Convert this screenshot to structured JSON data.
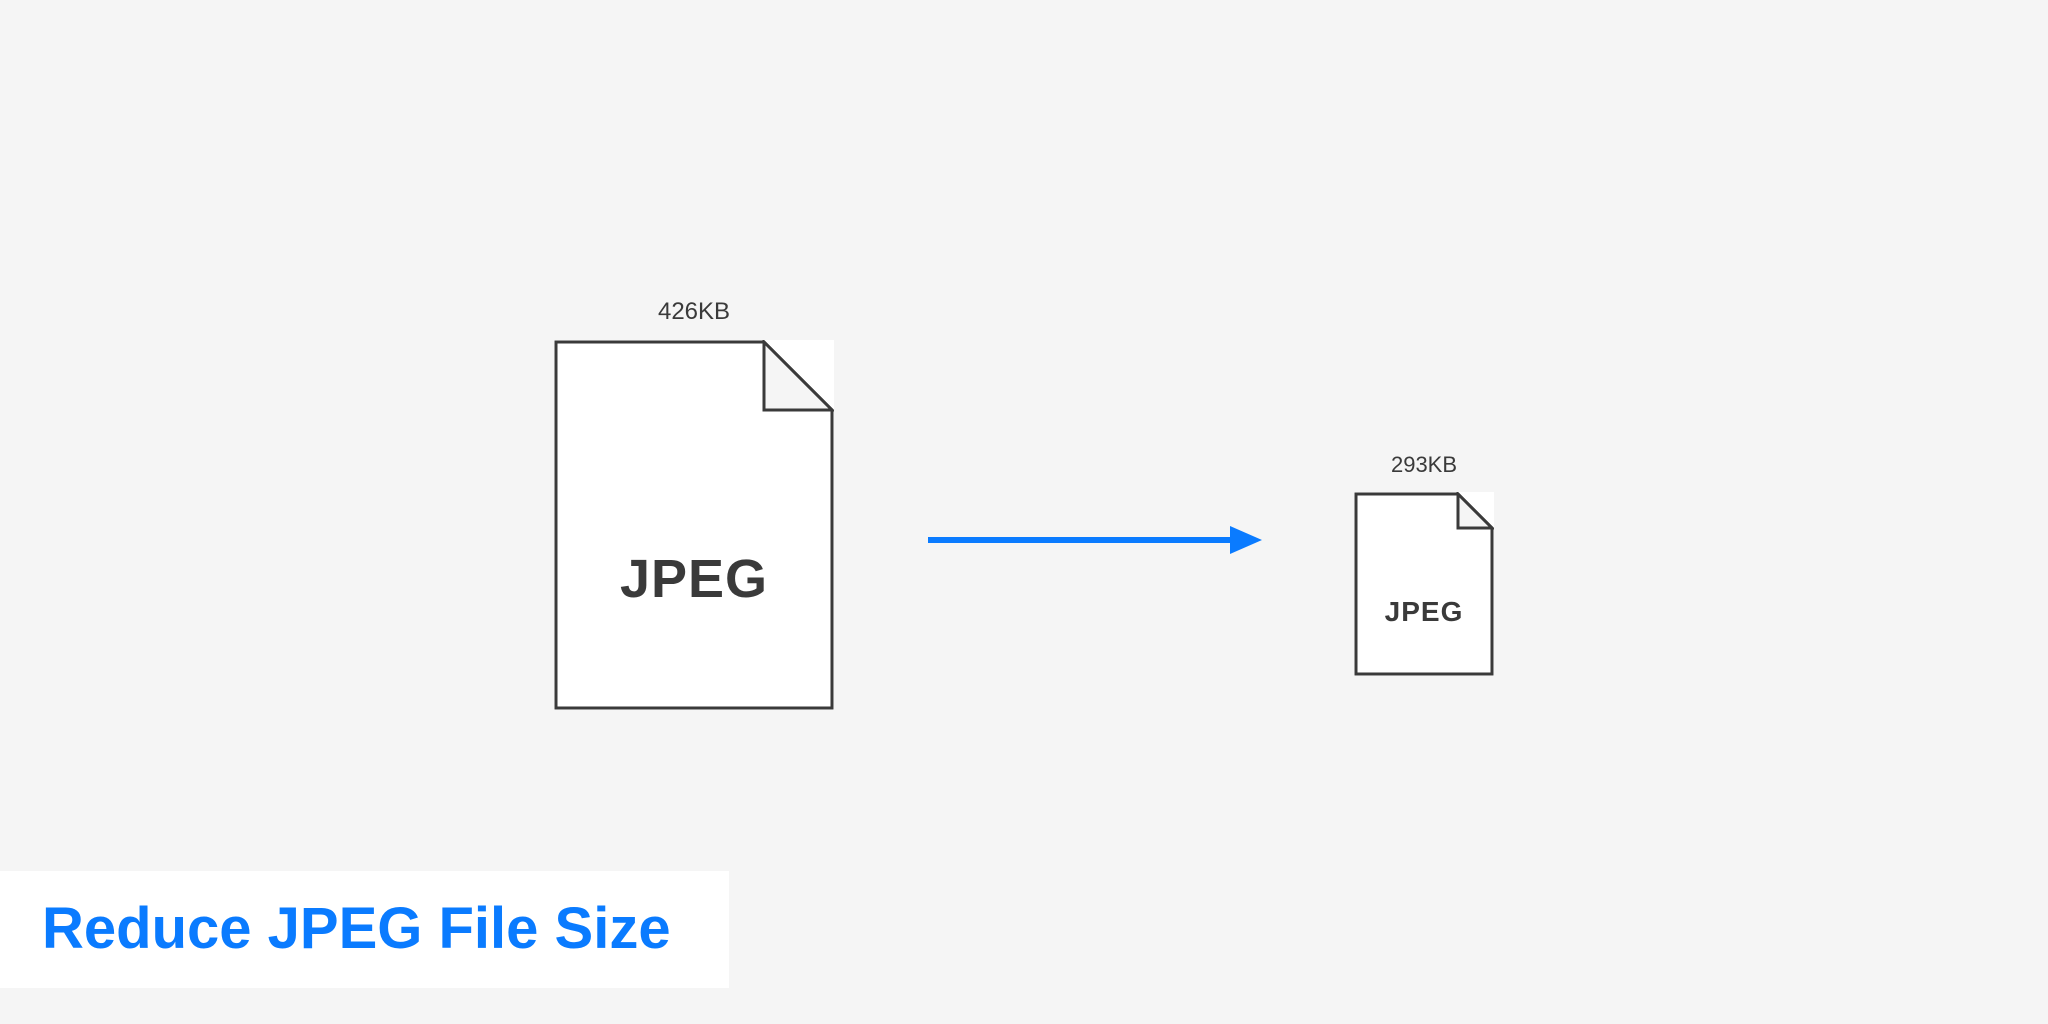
{
  "diagram": {
    "large_file": {
      "size_label": "426KB",
      "format_label": "JPEG"
    },
    "small_file": {
      "size_label": "293KB",
      "format_label": "JPEG"
    }
  },
  "caption": "Reduce JPEG File Size",
  "colors": {
    "arrow": "#0a7bff",
    "icon_stroke": "#3a3a3a",
    "caption_text": "#0a7bff",
    "page_bg": "#f5f5f5"
  }
}
